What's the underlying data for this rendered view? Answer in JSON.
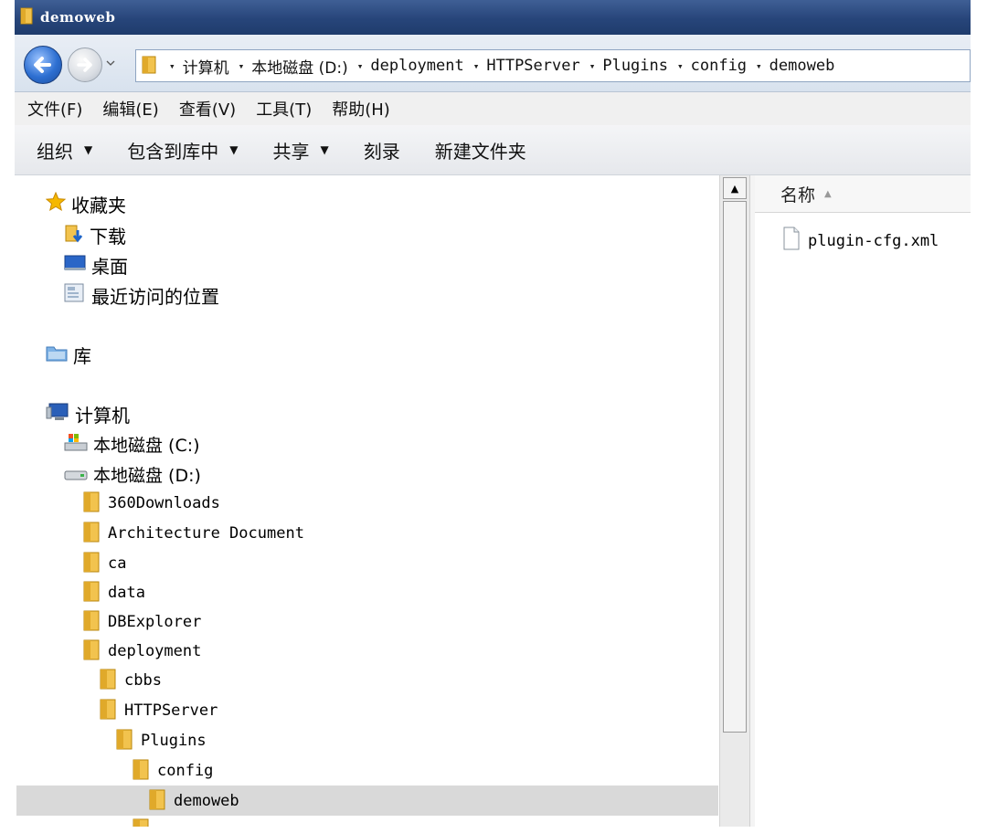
{
  "window": {
    "title": "demoweb"
  },
  "address": {
    "breadcrumbs": [
      "计算机",
      "本地磁盘 (D:)",
      "deployment",
      "HTTPServer",
      "Plugins",
      "config",
      "demoweb"
    ]
  },
  "menu": [
    "文件(F)",
    "编辑(E)",
    "查看(V)",
    "工具(T)",
    "帮助(H)"
  ],
  "toolbar": {
    "organize": "组织",
    "include_in_library": "包含到库中",
    "share": "共享",
    "burn": "刻录",
    "new_folder": "新建文件夹"
  },
  "nav": {
    "favorites": "收藏夹",
    "downloads": "下载",
    "desktop": "桌面",
    "recent": "最近访问的位置",
    "libraries": "库",
    "computer": "计算机",
    "disk_c": "本地磁盘 (C:)",
    "disk_d": "本地磁盘 (D:)",
    "folders": [
      "360Downloads",
      "Architecture Document",
      "ca",
      "data",
      "DBExplorer",
      "deployment"
    ],
    "deployment_children": [
      "cbbs",
      "HTTPServer"
    ],
    "plugins": "Plugins",
    "config": "config",
    "demoweb": "demoweb"
  },
  "content": {
    "column_name": "名称",
    "files": [
      "plugin-cfg.xml"
    ]
  },
  "colors": {
    "selected_row": "#d9d9d9",
    "titlebar": "#27457a"
  }
}
